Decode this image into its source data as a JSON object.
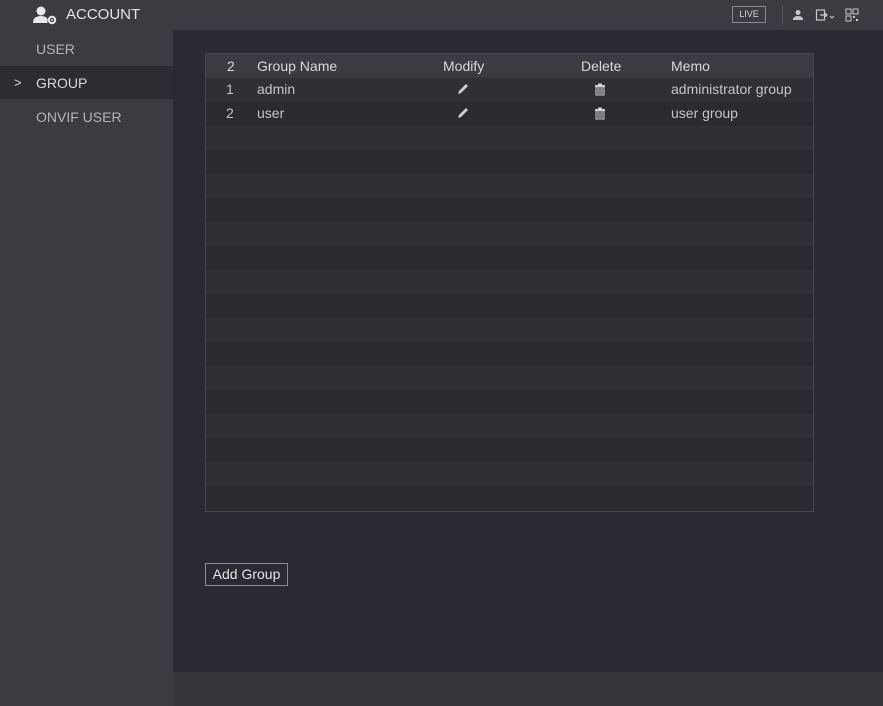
{
  "header": {
    "title": "ACCOUNT",
    "live_label": "LIVE",
    "icons": [
      "account-settings-icon",
      "user-icon",
      "logout-icon",
      "qr-code-icon"
    ]
  },
  "sidebar": {
    "items": [
      {
        "label": "USER",
        "active": false
      },
      {
        "label": "GROUP",
        "active": true,
        "chevron": ">"
      },
      {
        "label": "ONVIF USER",
        "active": false
      }
    ]
  },
  "groups_table": {
    "columns": {
      "count": "2",
      "name": "Group Name",
      "modify": "Modify",
      "delete": "Delete",
      "memo": "Memo"
    },
    "rows": [
      {
        "index": "1",
        "name": "admin",
        "memo": "administrator group",
        "modify_icon": "pencil-icon",
        "delete_icon": "trash-icon"
      },
      {
        "index": "2",
        "name": "user",
        "memo": "user group",
        "modify_icon": "pencil-icon",
        "delete_icon": "trash-icon"
      }
    ]
  },
  "actions": {
    "add_group_label": "Add Group"
  }
}
